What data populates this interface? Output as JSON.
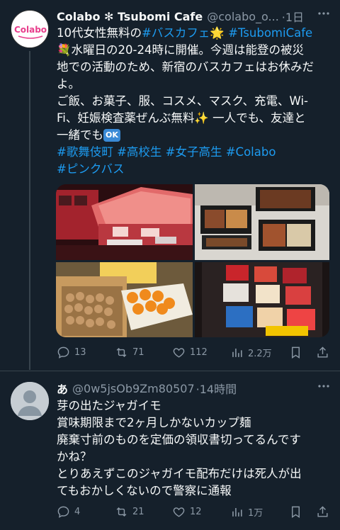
{
  "tweet1": {
    "name": "Colabo ✻ Tsubomi Cafe",
    "handle": "@colabo_o...",
    "time": "·1日",
    "avatar_logo": "Colabo",
    "line1_a": "10代女性無料の",
    "line1_tag1": "#バスカフェ",
    "line1_star": "🌟",
    "line1_tag2": "#TsubomiCafe",
    "line2": "💐水曜日の20-24時に開催。今週は能登の被災",
    "line3": "地での活動のため、新宿のバスカフェはお休みだ",
    "line4": "よ。",
    "line5": "ご飯、お菓子、服、コスメ、マスク、充電、Wi-",
    "line6": "Fi、妊娠検査薬ぜんぶ無料✨ 一人でも、友達と",
    "line7": "一緒でも",
    "ok_emoji": "OK",
    "tags_row1": [
      "#歌舞伎町",
      "#高校生",
      "#女子高生",
      "#Colabo"
    ],
    "tags_row2": [
      "#ピンクバス"
    ],
    "stats": {
      "replies": "13",
      "retweets": "71",
      "likes": "112",
      "views": "2.2万"
    }
  },
  "tweet2": {
    "name": "あ",
    "handle": "@0w5jsOb9Zm80507",
    "time": "·14時間",
    "lines": [
      "芽の出たジャガイモ",
      "賞味期限まで2ヶ月しかないカップ麺",
      "廃棄寸前のものを定価の領収書切ってるんです",
      "かね？",
      "とりあえずこのジャガイモ配布だけは死人が出",
      "てもおかしくないので警察に通報"
    ],
    "stats": {
      "replies": "4",
      "retweets": "21",
      "likes": "12",
      "views": "1万"
    }
  },
  "icons": [
    "reply-icon",
    "retweet-icon",
    "like-icon",
    "views-icon",
    "bookmark-icon",
    "share-icon"
  ],
  "colors": {
    "background": "#15202b",
    "hashtag": "#1d9bf0",
    "secondary": "#8b98a5",
    "border": "#38444d"
  }
}
